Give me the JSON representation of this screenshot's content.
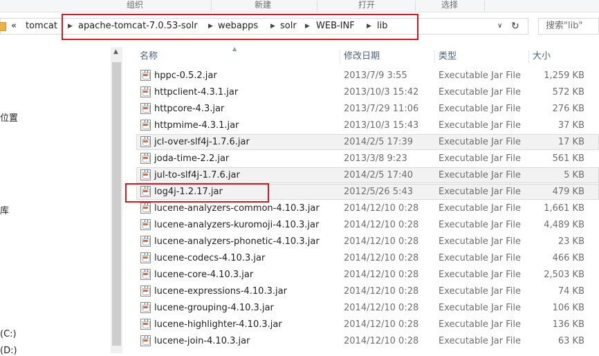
{
  "ribbon": {
    "groups": [
      "组织",
      "新建",
      "打开",
      "选择"
    ]
  },
  "address": {
    "overflow": "«",
    "crumbs": [
      "tomcat",
      "apache-tomcat-7.0.53-solr",
      "webapps",
      "solr",
      "WEB-INF",
      "lib"
    ],
    "dropdown_glyph": "∨",
    "refresh_glyph": "↻"
  },
  "search": {
    "placeholder": "搜索\"lib\""
  },
  "nav": {
    "fragments": [
      "位置",
      "库",
      "(C:)",
      "(D:)"
    ]
  },
  "columns": {
    "name": "名称",
    "date": "修改日期",
    "type": "类型",
    "size": "大小"
  },
  "files": [
    {
      "name": "hppc-0.5.2.jar",
      "date": "2013/7/9 3:55",
      "type": "Executable Jar File",
      "size": "1,259 KB"
    },
    {
      "name": "httpclient-4.3.1.jar",
      "date": "2013/10/3 15:42",
      "type": "Executable Jar File",
      "size": "572 KB"
    },
    {
      "name": "httpcore-4.3.jar",
      "date": "2013/7/29 11:06",
      "type": "Executable Jar File",
      "size": "276 KB"
    },
    {
      "name": "httpmime-4.3.1.jar",
      "date": "2013/10/3 15:43",
      "type": "Executable Jar File",
      "size": "37 KB"
    },
    {
      "name": "jcl-over-slf4j-1.7.6.jar",
      "date": "2014/2/5 17:39",
      "type": "Executable Jar File",
      "size": "17 KB"
    },
    {
      "name": "joda-time-2.2.jar",
      "date": "2013/3/8 9:23",
      "type": "Executable Jar File",
      "size": "561 KB"
    },
    {
      "name": "jul-to-slf4j-1.7.6.jar",
      "date": "2014/2/5 17:40",
      "type": "Executable Jar File",
      "size": "5 KB"
    },
    {
      "name": "log4j-1.2.17.jar",
      "date": "2012/5/26 5:43",
      "type": "Executable Jar File",
      "size": "479 KB"
    },
    {
      "name": "lucene-analyzers-common-4.10.3.jar",
      "date": "2014/12/10 0:28",
      "type": "Executable Jar File",
      "size": "1,661 KB"
    },
    {
      "name": "lucene-analyzers-kuromoji-4.10.3.jar",
      "date": "2014/12/10 0:28",
      "type": "Executable Jar File",
      "size": "4,489 KB"
    },
    {
      "name": "lucene-analyzers-phonetic-4.10.3.jar",
      "date": "2014/12/10 0:28",
      "type": "Executable Jar File",
      "size": "23 KB"
    },
    {
      "name": "lucene-codecs-4.10.3.jar",
      "date": "2014/12/10 0:28",
      "type": "Executable Jar File",
      "size": "466 KB"
    },
    {
      "name": "lucene-core-4.10.3.jar",
      "date": "2014/12/10 0:28",
      "type": "Executable Jar File",
      "size": "2,503 KB"
    },
    {
      "name": "lucene-expressions-4.10.3.jar",
      "date": "2014/12/10 0:28",
      "type": "Executable Jar File",
      "size": "74 KB"
    },
    {
      "name": "lucene-grouping-4.10.3.jar",
      "date": "2014/12/10 0:28",
      "type": "Executable Jar File",
      "size": "106 KB"
    },
    {
      "name": "lucene-highlighter-4.10.3.jar",
      "date": "2014/12/10 0:28",
      "type": "Executable Jar File",
      "size": "136 KB"
    },
    {
      "name": "lucene-join-4.10.3.jar",
      "date": "2014/12/10 0:28",
      "type": "Executable Jar File",
      "size": "63 KB"
    }
  ],
  "icons": {
    "file": "jar-file-icon",
    "folder": "folder-icon"
  },
  "colors": {
    "highlight": "#e0141e",
    "header_text": "#4c607a"
  }
}
